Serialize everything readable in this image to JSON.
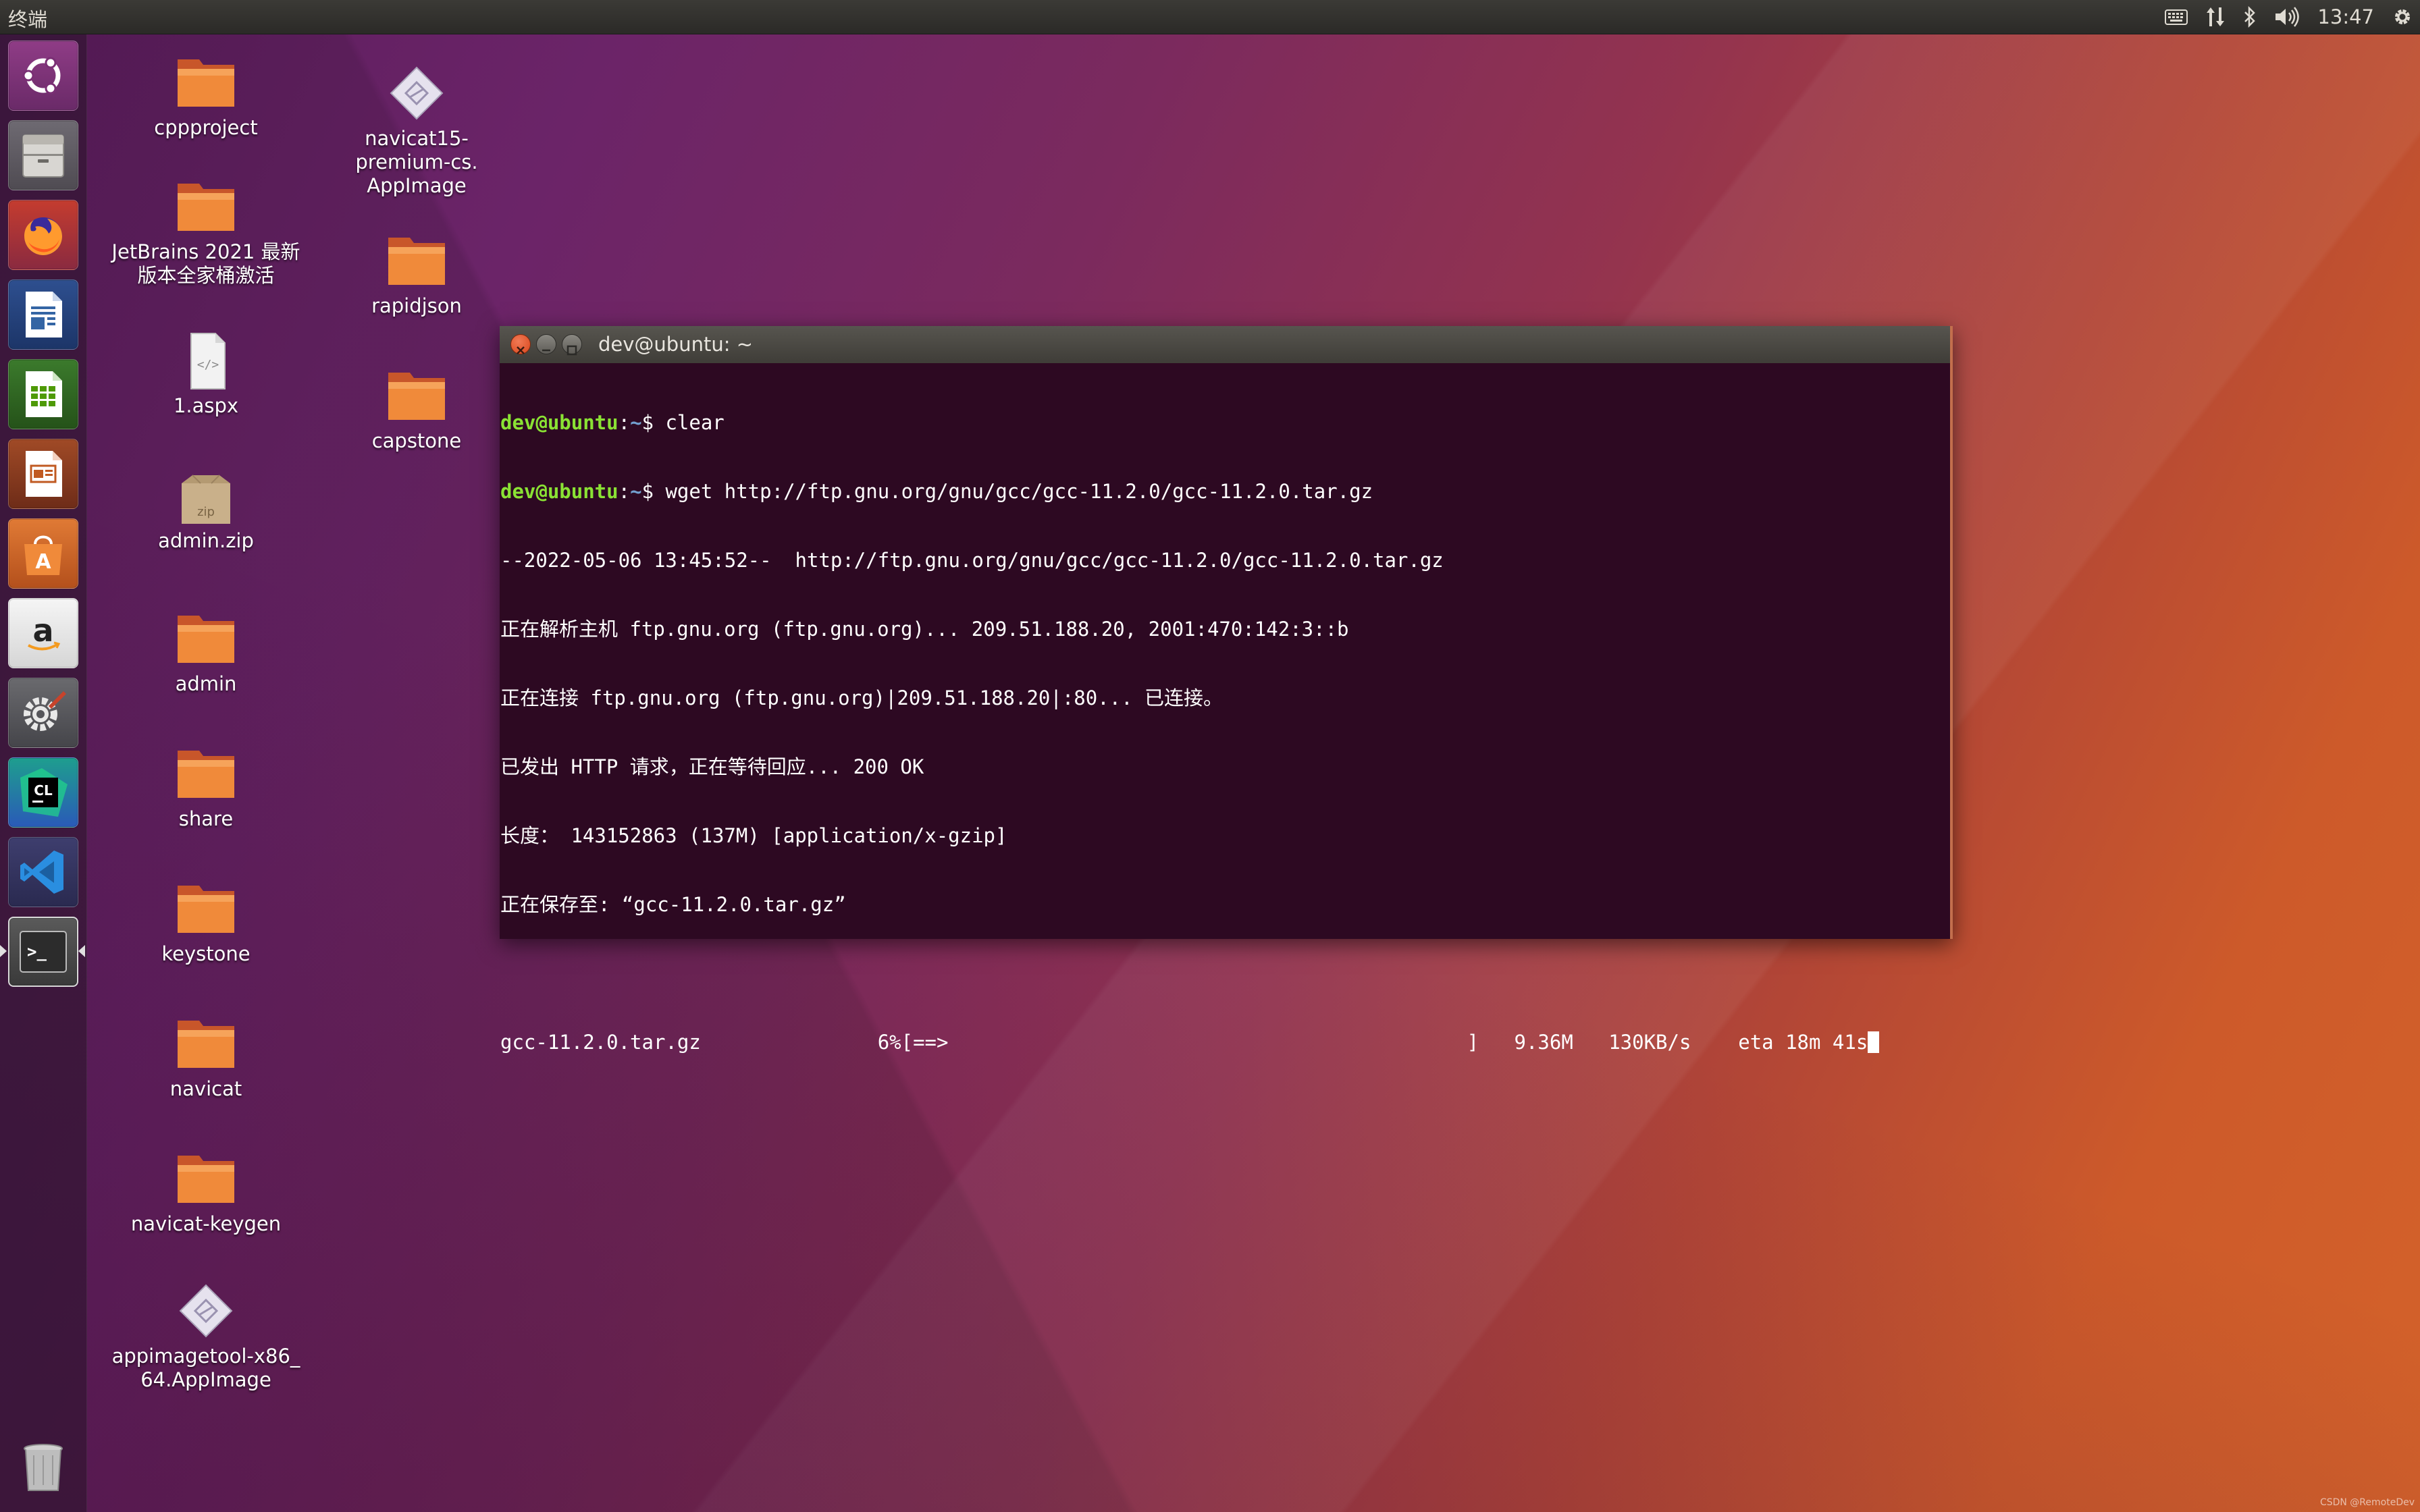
{
  "top_panel": {
    "app_title": "终端",
    "clock": "13:47",
    "indicators": [
      "keyboard-icon",
      "network-updown-icon",
      "bluetooth-icon",
      "volume-icon",
      "settings-gear-icon"
    ]
  },
  "launcher": {
    "items": [
      {
        "name": "ubuntu-dash-icon",
        "label": "Ubuntu Dash"
      },
      {
        "name": "files-icon",
        "label": "Files"
      },
      {
        "name": "firefox-icon",
        "label": "Firefox"
      },
      {
        "name": "libreoffice-writer-icon",
        "label": "LibreOffice Writer"
      },
      {
        "name": "libreoffice-calc-icon",
        "label": "LibreOffice Calc"
      },
      {
        "name": "libreoffice-impress-icon",
        "label": "LibreOffice Impress"
      },
      {
        "name": "software-center-icon",
        "label": "Ubuntu Software"
      },
      {
        "name": "amazon-icon",
        "label": "Amazon"
      },
      {
        "name": "system-settings-icon",
        "label": "System Settings"
      },
      {
        "name": "clion-icon",
        "label": "CLion",
        "glyph": "CL"
      },
      {
        "name": "vscode-icon",
        "label": "Visual Studio Code"
      },
      {
        "name": "terminal-icon",
        "label": "Terminal",
        "glyph": ">_"
      },
      {
        "name": "trash-icon",
        "label": "Trash"
      }
    ]
  },
  "desktop_icons": {
    "cppproject": "cppproject",
    "jetbrains_line1": "JetBrains 2021 最新",
    "jetbrains_line2": "版本全家桶激活",
    "aspx": "1.aspx",
    "aspx_glyph": "</>",
    "admin_zip": "admin.zip",
    "zip_glyph": "zip",
    "admin": "admin",
    "share": "share",
    "keystone": "keystone",
    "navicat": "navicat",
    "navicat_keygen": "navicat-keygen",
    "appimagetool_line1": "appimagetool-x86_",
    "appimagetool_line2": "64.AppImage",
    "navicat15_line1": "navicat15-",
    "navicat15_line2": "premium-cs.",
    "navicat15_line3": "AppImage",
    "rapidjson": "rapidjson",
    "capstone": "capstone"
  },
  "terminal": {
    "title": "dev@ubuntu: ~",
    "prompt_user": "dev@ubuntu",
    "prompt_sep": ":",
    "prompt_path": "~",
    "prompt_symbol": "$ ",
    "commands": [
      "clear",
      "wget http://ftp.gnu.org/gnu/gcc/gcc-11.2.0/gcc-11.2.0.tar.gz"
    ],
    "output": [
      "--2022-05-06 13:45:52--  http://ftp.gnu.org/gnu/gcc/gcc-11.2.0/gcc-11.2.0.tar.gz",
      "正在解析主机 ftp.gnu.org (ftp.gnu.org)... 209.51.188.20, 2001:470:142:3::b",
      "正在连接 ftp.gnu.org (ftp.gnu.org)|209.51.188.20|:80... 已连接。",
      "已发出 HTTP 请求，正在等待回应... 200 OK",
      "长度： 143152863 (137M) [application/x-gzip]",
      "正在保存至: “gcc-11.2.0.tar.gz”"
    ],
    "progress_line": "gcc-11.2.0.tar.gz               6%[==>                                            ]   9.36M   130KB/s    eta 18m 41s",
    "progress_percent": 6
  },
  "watermark": "CSDN @RemoteDev",
  "colors": {
    "prompt_user": "#8ae234",
    "prompt_path": "#729fcf",
    "terminal_bg": "#2d0922",
    "close_button": "#e95420"
  }
}
